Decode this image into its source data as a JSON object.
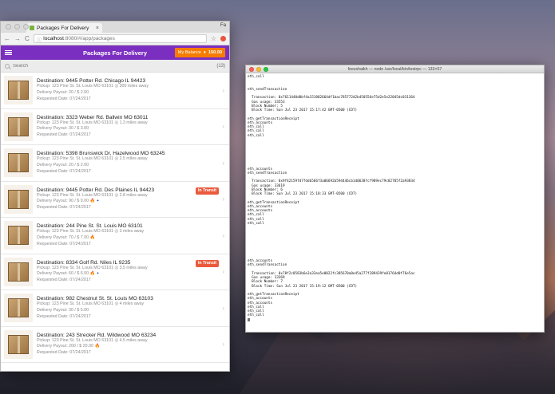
{
  "browser": {
    "tab_title": "Packages For Delivery",
    "profile": "Fa",
    "url_host": "localhost",
    "url_path": ":8080/#/app/packages",
    "close_glyph": "×"
  },
  "app": {
    "title": "Packages For Delivery",
    "balance_label": "My Balance",
    "balance_value": "150.00",
    "search_placeholder": "Search",
    "package_count": "(13)",
    "fab_label": "+"
  },
  "packages": [
    {
      "destination": "Destination: 9445 Potter Rd. Chicago IL 94423",
      "pickup": "Pickup: 123 Pine St. St. Louis MO 63101",
      "distance": "300 miles away",
      "payout": "Delivery Payout: 20 / $ 2.00",
      "date": "Requested Date: 07/24/2017",
      "badge": "",
      "extras": ""
    },
    {
      "destination": "Destination: 3323 Weber Rd. Ballwin MO 63011",
      "pickup": "Pickup: 123 Pine St. St. Louis MO 63101",
      "distance": "1.3 miles away",
      "payout": "Delivery Payout: 30 / $ 3.00",
      "date": "Requested Date: 07/24/2017",
      "badge": "",
      "extras": ""
    },
    {
      "destination": "Destination: 5398 Brunswick Dr, Hazelwood MO 63245",
      "pickup": "Pickup: 123 Pine St. St. Louis MO 63101",
      "distance": "2.5 miles away",
      "payout": "Delivery Payout: 20 / $ 2.00",
      "date": "Requested Date: 07/24/2017",
      "badge": "",
      "extras": ""
    },
    {
      "destination": "Destination: 9445 Potter Rd. Des Plaines IL 94423",
      "pickup": "Pickup: 123 Pine St. St. Louis MO 63101",
      "distance": "2.8 miles away",
      "payout": "Delivery Payout: 90 / $ 9.00",
      "date": "Requested Date: 07/24/2017",
      "badge": "In Transit",
      "extras": "flame-flag"
    },
    {
      "destination": "Destination: 244 Pine St. St. Louis MO 63101",
      "pickup": "Pickup: 123 Pine St. St. Louis MO 63101",
      "distance": "3 miles away",
      "payout": "Delivery Payout: 70 / $ 7.00",
      "date": "Requested Date: 07/24/2017",
      "badge": "",
      "extras": "flame"
    },
    {
      "destination": "Destination: 8334 Golf Rd. Niles IL 9235",
      "pickup": "Pickup: 123 Pine St. St. Louis MO 63101",
      "distance": "3.5 miles away",
      "payout": "Delivery Payout: 60 / $ 6.00",
      "date": "Requested Date: 07/24/2017",
      "badge": "In Transit",
      "extras": "flame-flag"
    },
    {
      "destination": "Destination: 982 Chestnut St. St. Louis MO 63103",
      "pickup": "Pickup: 123 Pine St. St. Louis MO 63101",
      "distance": "4 miles away",
      "payout": "Delivery Payout: 30 / $ 5.00",
      "date": "Requested Date: 07/24/2017",
      "badge": "",
      "extras": ""
    },
    {
      "destination": "Destination: 243 Strecker Rd. Wildwood MO 63234",
      "pickup": "Pickup: 123 Pine St. St. Louis MO 63101",
      "distance": "4.5 miles away",
      "payout": "Delivery Payout: 200 / $ 20.00",
      "date": "Requested Date: 07/24/2017",
      "badge": "",
      "extras": "flame"
    }
  ],
  "terminal": {
    "title": "feezshaikh — node /usr/local/bin/testrpc — 133×57",
    "lines": [
      "eth_call",
      "",
      "",
      "eth_sendTransaction",
      "",
      "  Transaction: 0x7611440d0bf4a151082664df1bac785772d2b450556e75d2e5e22045dc031364",
      "  Gas usage: 33553",
      "  Block Number: 5",
      "  Block Time: Sun Jul 23 2017 15:17:42 GMT-0500 (CDT)",
      "",
      "eth_getTransactionReceipt",
      "eth_accounts",
      "eth_call",
      "eth_call",
      "eth_call",
      "",
      "",
      "",
      "",
      "",
      "",
      "",
      "eth_accounts",
      "eth_sendTransaction",
      "",
      "  Transaction: 0x9f42159fd7fddb566f3a06692b594446cb1d0638fcf989ec79c82785f2a93834",
      "  Gas usage: 33619",
      "  Block Number: 6",
      "  Block Time: Sun Jul 23 2017 15:18:33 GMT-0500 (CDT)",
      "",
      "eth_getTransactionReceipt",
      "eth_accounts",
      "eth_accounts",
      "eth_call",
      "eth_call",
      "eth_call",
      "",
      "",
      "",
      "",
      "",
      "",
      "",
      "",
      "eth_accounts",
      "eth_sendTransaction",
      "",
      "  Transaction: 0x70f2c0583b6e3a33ea5e0022fc385670a0e45a277f289439fe01764d0f76e5ac",
      "  Gas usage: 33369",
      "  Block Number: 7",
      "  Block Time: Sun Jul 23 2017 15:19:12 GMT-0500 (CDT)",
      "",
      "eth_getTransactionReceipt",
      "eth_accounts",
      "eth_accounts",
      "eth_call",
      "eth_call",
      "eth_call"
    ]
  },
  "colors": {
    "app_bar": "#7b2fc0",
    "balance": "#f57c00",
    "badge": "#ea5a3c"
  }
}
